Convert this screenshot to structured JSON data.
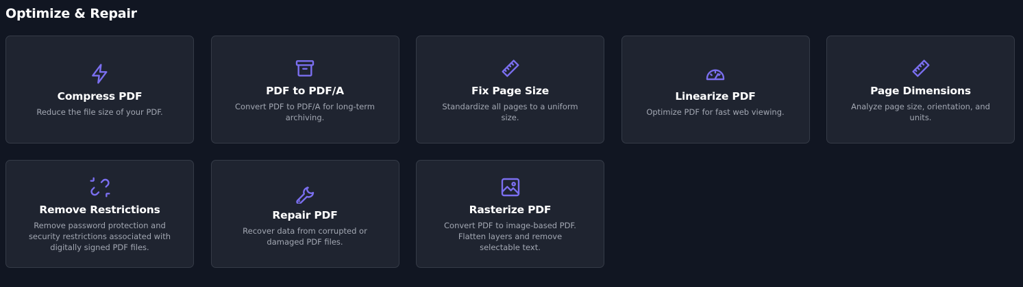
{
  "section": {
    "title": "Optimize & Repair"
  },
  "accent_color": "#7b6ff0",
  "tools": [
    {
      "title": "Compress PDF",
      "description": "Reduce the file size of your PDF.",
      "icon": "lightning-icon"
    },
    {
      "title": "PDF to PDF/A",
      "description": "Convert PDF to PDF/A for long-term archiving.",
      "icon": "archive-box-icon"
    },
    {
      "title": "Fix Page Size",
      "description": "Standardize all pages to a uniform size.",
      "icon": "ruler-icon"
    },
    {
      "title": "Linearize PDF",
      "description": "Optimize PDF for fast web viewing.",
      "icon": "gauge-icon"
    },
    {
      "title": "Page Dimensions",
      "description": "Analyze page size, orientation, and units.",
      "icon": "ruler-icon"
    },
    {
      "title": "Remove Restrictions",
      "description": "Remove password protection and security restrictions associated with digitally signed PDF files.",
      "icon": "broken-link-icon"
    },
    {
      "title": "Repair PDF",
      "description": "Recover data from corrupted or damaged PDF files.",
      "icon": "wrench-icon"
    },
    {
      "title": "Rasterize PDF",
      "description": "Convert PDF to image-based PDF. Flatten layers and remove selectable text.",
      "icon": "image-icon"
    }
  ]
}
